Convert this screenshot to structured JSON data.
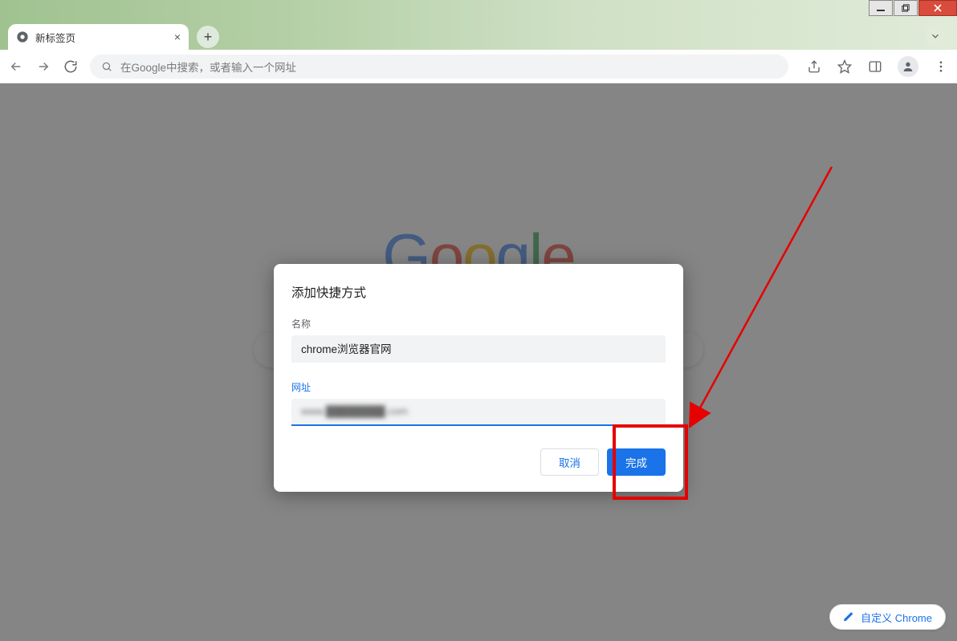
{
  "window": {
    "tab_title": "新标签页"
  },
  "toolbar": {
    "omnibox_placeholder": "在Google中搜索，或者输入一个网址"
  },
  "dialog": {
    "title": "添加快捷方式",
    "name_label": "名称",
    "name_value": "chrome浏览器官网",
    "url_label": "网址",
    "url_value_blurred": "www.████████.com",
    "cancel_label": "取消",
    "done_label": "完成"
  },
  "customize": {
    "label": "自定义 Chrome"
  },
  "google_logo_letters": [
    "G",
    "o",
    "o",
    "g",
    "l",
    "e"
  ]
}
